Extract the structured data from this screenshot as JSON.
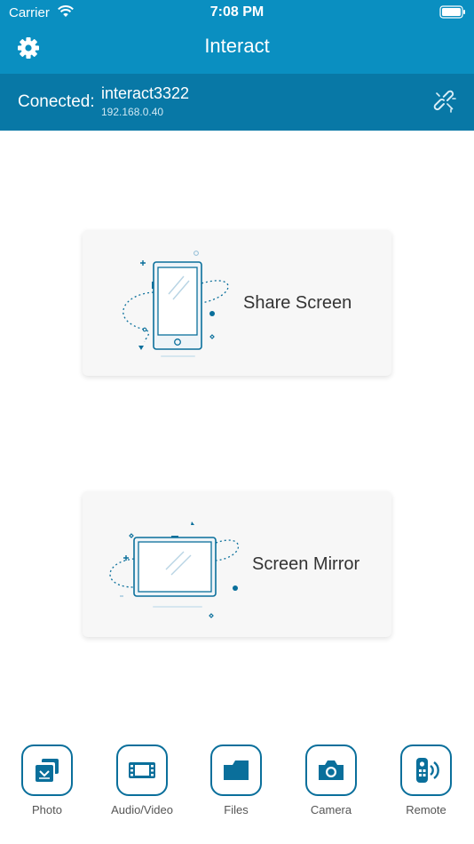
{
  "status_bar": {
    "carrier": "Carrier",
    "time": "7:08 PM"
  },
  "header": {
    "title": "Interact"
  },
  "connection": {
    "label": "Conected:",
    "device_name": "interact3322",
    "ip": "192.168.0.40"
  },
  "cards": [
    {
      "label": "Share Screen"
    },
    {
      "label": "Screen Mirror"
    }
  ],
  "tabs": [
    {
      "label": "Photo",
      "icon": "photo-icon"
    },
    {
      "label": "Audio/Video",
      "icon": "film-icon"
    },
    {
      "label": "Files",
      "icon": "folder-icon"
    },
    {
      "label": "Camera",
      "icon": "camera-icon"
    },
    {
      "label": "Remote",
      "icon": "remote-icon"
    }
  ],
  "colors": {
    "header": "#0a8fc1",
    "connection_bar": "#0878a6",
    "accent": "#0a6f9b"
  }
}
